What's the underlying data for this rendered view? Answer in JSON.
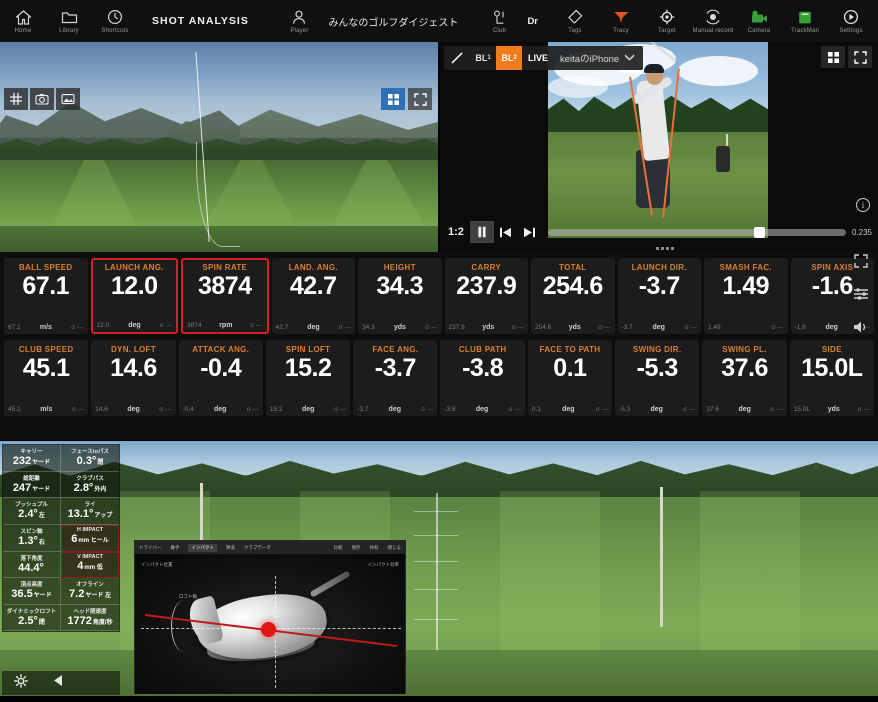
{
  "topbar": {
    "nav": [
      {
        "label": "Home",
        "icon": "home-icon"
      },
      {
        "label": "Library",
        "icon": "folder-icon"
      },
      {
        "label": "Shortcuts",
        "icon": "clock-icon"
      }
    ],
    "title": "SHOT ANALYSIS",
    "player": {
      "label": "Player",
      "name": "みんなのゴルフダイジェスト",
      "icon": "person-icon"
    },
    "club": {
      "label": "Club",
      "value": "Dr",
      "icon": "club-icon"
    },
    "tags": {
      "label": "Tags",
      "icon": "tag-icon"
    },
    "right": [
      {
        "label": "Tracy",
        "icon": "tracy-icon"
      },
      {
        "label": "Target",
        "icon": "target-icon"
      },
      {
        "label": "Manual record",
        "icon": "record-icon"
      },
      {
        "label": "Camera",
        "icon": "camera-icon"
      },
      {
        "label": "TrackMan",
        "icon": "trackman-icon"
      },
      {
        "label": "Settings",
        "icon": "settings-icon"
      }
    ]
  },
  "left_camera": {
    "tools": [
      {
        "name": "grid-icon",
        "label": "#"
      },
      {
        "name": "camera-icon",
        "label": ""
      },
      {
        "name": "image-icon",
        "label": ""
      }
    ],
    "view_buttons": [
      {
        "name": "multi-view-icon",
        "active": true
      },
      {
        "name": "fullscreen-icon",
        "active": false
      }
    ]
  },
  "video": {
    "tools": {
      "draw_label": "",
      "bl1_label": "BL",
      "bl1_sub": "1",
      "bl2_label": "BL",
      "bl2_sub": "2",
      "live_label": "LIVE",
      "device": "keitaのiPhone"
    },
    "controls": {
      "speed": "1:2",
      "pause": "pause-icon",
      "prev_frame": "prev-frame-icon",
      "next_frame": "next-frame-icon",
      "time": "0.235"
    },
    "view_buttons": [
      {
        "name": "multi-view-icon"
      },
      {
        "name": "fullscreen-icon"
      }
    ],
    "info_label": "i"
  },
  "metrics": {
    "row1": [
      {
        "label": "BALL SPEED",
        "value": "67.1",
        "sub": "67.1",
        "unit": "m/s",
        "sigma": "σ ---",
        "highlight": false
      },
      {
        "label": "LAUNCH ANG.",
        "value": "12.0",
        "sub": "12.0",
        "unit": "deg",
        "sigma": "σ ---",
        "highlight": true
      },
      {
        "label": "SPIN RATE",
        "value": "3874",
        "sub": "3874",
        "unit": "rpm",
        "sigma": "σ ---",
        "highlight": true
      },
      {
        "label": "LAND. ANG.",
        "value": "42.7",
        "sub": "42.7",
        "unit": "deg",
        "sigma": "σ ---",
        "highlight": false
      },
      {
        "label": "HEIGHT",
        "value": "34.3",
        "sub": "34.3",
        "unit": "yds",
        "sigma": "σ ---",
        "highlight": false
      },
      {
        "label": "CARRY",
        "value": "237.9",
        "sub": "237.9",
        "unit": "yds",
        "sigma": "σ ---",
        "highlight": false
      },
      {
        "label": "TOTAL",
        "value": "254.6",
        "sub": "254.6",
        "unit": "yds",
        "sigma": "σ ---",
        "highlight": false
      },
      {
        "label": "LAUNCH DIR.",
        "value": "-3.7",
        "sub": "-3.7",
        "unit": "deg",
        "sigma": "σ ---",
        "highlight": false
      },
      {
        "label": "SMASH FAC.",
        "value": "1.49",
        "sub": "1.49",
        "unit": "",
        "sigma": "σ ---",
        "highlight": false
      },
      {
        "label": "SPIN AXIS",
        "value": "-1.6",
        "sub": "-1.6",
        "unit": "deg",
        "sigma": "σ ---",
        "highlight": false
      }
    ],
    "row2": [
      {
        "label": "CLUB SPEED",
        "value": "45.1",
        "sub": "45.1",
        "unit": "m/s",
        "sigma": "σ ---",
        "highlight": false
      },
      {
        "label": "DYN. LOFT",
        "value": "14.6",
        "sub": "14.6",
        "unit": "deg",
        "sigma": "σ ---",
        "highlight": false
      },
      {
        "label": "ATTACK ANG.",
        "value": "-0.4",
        "sub": "-0.4",
        "unit": "deg",
        "sigma": "σ ---",
        "highlight": false
      },
      {
        "label": "SPIN LOFT",
        "value": "15.2",
        "sub": "15.2",
        "unit": "deg",
        "sigma": "σ ---",
        "highlight": false
      },
      {
        "label": "FACE ANG.",
        "value": "-3.7",
        "sub": "-3.7",
        "unit": "deg",
        "sigma": "σ ---",
        "highlight": false
      },
      {
        "label": "CLUB PATH",
        "value": "-3.8",
        "sub": "-3.8",
        "unit": "deg",
        "sigma": "σ ---",
        "highlight": false
      },
      {
        "label": "FACE TO PATH",
        "value": "0.1",
        "sub": "0.1",
        "unit": "deg",
        "sigma": "σ ---",
        "highlight": false
      },
      {
        "label": "SWING DIR.",
        "value": "-5.3",
        "sub": "-5.3",
        "unit": "deg",
        "sigma": "σ ---",
        "highlight": false
      },
      {
        "label": "SWING PL.",
        "value": "37.6",
        "sub": "37.6",
        "unit": "deg",
        "sigma": "σ ---",
        "highlight": false
      },
      {
        "label": "SIDE",
        "value": "15.0L",
        "sub": "15.0L",
        "unit": "yds",
        "sigma": "σ ---",
        "highlight": false
      }
    ],
    "side_buttons": [
      {
        "name": "expand-icon"
      },
      {
        "name": "sliders-icon"
      },
      {
        "name": "volume-icon"
      }
    ]
  },
  "sim_hud": {
    "cells": [
      {
        "label": "キャリー",
        "value": "232",
        "unit": "ヤード",
        "highlight": false
      },
      {
        "label": "フェースtoパス",
        "value": "0.3°",
        "unit": "閉",
        "highlight": false
      },
      {
        "label": "総距離",
        "value": "247",
        "unit": "ヤード",
        "highlight": false
      },
      {
        "label": "クラブパス",
        "value": "2.8°",
        "unit": "外内",
        "highlight": false
      },
      {
        "label": "プッシュプル",
        "value": "2.4°",
        "unit": "左",
        "highlight": false
      },
      {
        "label": "ライ",
        "value": "13.1°",
        "unit": "アップ",
        "highlight": false
      },
      {
        "label": "スピン軸",
        "value": "1.3°",
        "unit": "右",
        "highlight": false
      },
      {
        "label": "H IMPACT",
        "value": "6",
        "unit": "mm ヒール",
        "highlight": true
      },
      {
        "label": "落下角度",
        "value": "44.4°",
        "unit": "",
        "highlight": false
      },
      {
        "label": "V IMPACT",
        "value": "4",
        "unit": "mm 低",
        "highlight": true
      },
      {
        "label": "頂点高度",
        "value": "36.5",
        "unit": "ヤード",
        "highlight": false
      },
      {
        "label": "オフライン",
        "value": "7.2",
        "unit": "ヤード 左",
        "highlight": false
      },
      {
        "label": "ダイナミックロフト",
        "value": "2.5°",
        "unit": "閉",
        "highlight": false
      },
      {
        "label": "ヘッド閉速度",
        "value": "1772",
        "unit": "角度/秒",
        "highlight": false
      }
    ],
    "footer": [
      {
        "name": "gear-icon"
      },
      {
        "name": "back-arrow-icon"
      }
    ]
  },
  "club_inset": {
    "tabs": [
      "ドライバー",
      "番手",
      "インパクト",
      "弾道",
      "クラブデータ"
    ],
    "right_items": [
      "比較",
      "保存",
      "共有",
      "閉じる"
    ],
    "left_label": "インパクト位置",
    "right_label": "インパクト効率",
    "loft_label": "ロフト角"
  }
}
